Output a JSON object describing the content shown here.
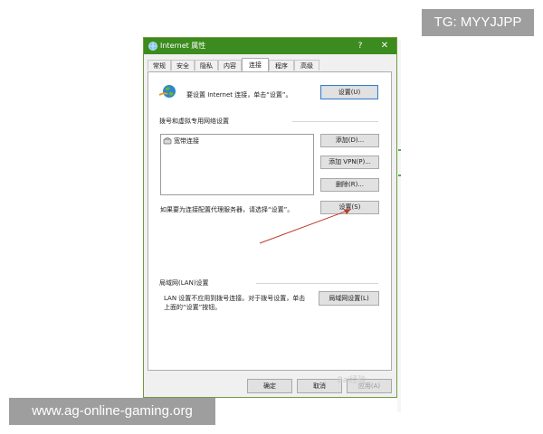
{
  "watermarks": {
    "tg": "TG: MYYJJPP",
    "site": "www.ag-online-gaming.org"
  },
  "dialog": {
    "title": "Internet 属性",
    "help": "?",
    "close": "✕",
    "tabs": [
      {
        "label": "常规"
      },
      {
        "label": "安全"
      },
      {
        "label": "隐私"
      },
      {
        "label": "内容"
      },
      {
        "label": "连接"
      },
      {
        "label": "程序"
      },
      {
        "label": "高级"
      }
    ],
    "active_tab": "连接"
  },
  "setup": {
    "text": "要设置 Internet 连接，单击“设置”。",
    "button": "设置(U)"
  },
  "dialup": {
    "heading": "拨号和虚拟专用网络设置",
    "connections": [
      {
        "name": "宽带连接"
      }
    ],
    "add": "添加(D)...",
    "add_vpn": "添加 VPN(P)...",
    "remove": "删除(R)...",
    "proxy_hint": "如果要为连接配置代理服务器，请选择“设置”。",
    "settings": "设置(S)"
  },
  "lan": {
    "heading": "局域网(LAN)设置",
    "text_line1": "LAN 设置不应用到拨号连接。对于拨号设置，单击",
    "text_line2": "上面的“设置”按钮。",
    "button": "局域网设置(L)"
  },
  "footer": {
    "ok": "确定",
    "cancel": "取消",
    "apply": "应用(A)",
    "baidu_mark": "Bai经验"
  }
}
